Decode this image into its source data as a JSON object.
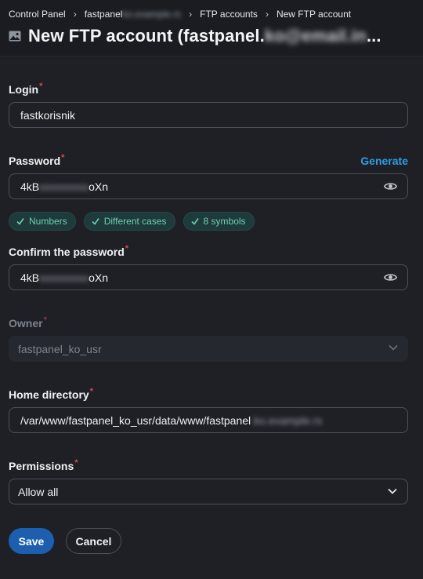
{
  "breadcrumb": {
    "items": [
      "Control Panel",
      "fastpanel",
      "FTP accounts",
      "New FTP account"
    ],
    "blurred_part": "ko.example.rs"
  },
  "page": {
    "title": "New FTP account (fastpanel.",
    "title_blurred": "ko@email.in",
    "title_suffix": "...",
    "icon": "image-icon"
  },
  "form": {
    "login": {
      "label": "Login",
      "value": "fastkorisnik"
    },
    "password": {
      "label": "Password",
      "generate_label": "Generate",
      "value_start": "4kB",
      "value_hidden": "xxxxxxxxx",
      "value_end": "oXn"
    },
    "checks": [
      "Numbers",
      "Different cases",
      "8 symbols"
    ],
    "confirm": {
      "label": "Confirm the password",
      "value_start": "4kB",
      "value_hidden": "xxxxxxxxx",
      "value_end": "oXn"
    },
    "owner": {
      "label": "Owner",
      "value": "fastpanel_ko_usr"
    },
    "home": {
      "label": "Home directory",
      "value": "/var/www/fastpanel_ko_usr/data/www/fastpanel",
      "value_hidden": ".ko.example.rs"
    },
    "permissions": {
      "label": "Permissions",
      "value": "Allow all"
    }
  },
  "actions": {
    "save": "Save",
    "cancel": "Cancel"
  },
  "colors": {
    "background": "#1e2026",
    "accent": "#2f9ee2",
    "primary_button": "#1c5fae",
    "required": "#e0484f",
    "chip_text": "#6ecfb4"
  }
}
